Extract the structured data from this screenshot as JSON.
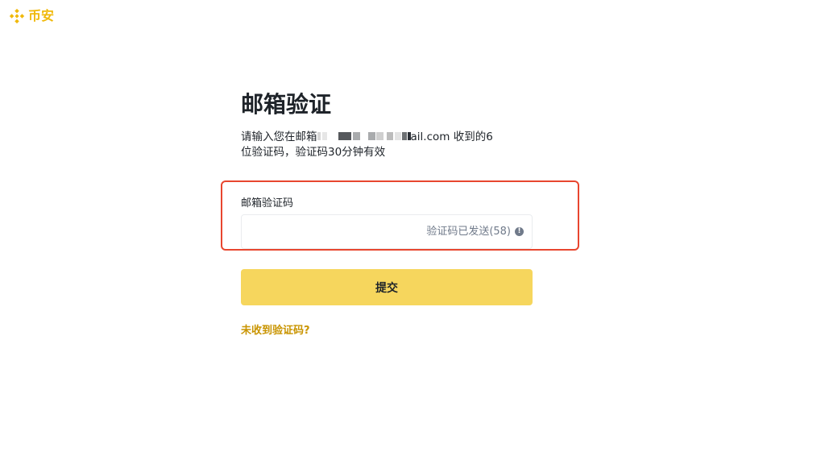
{
  "brand": {
    "name": "币安",
    "color": "#F0B90B"
  },
  "page": {
    "title": "邮箱验证",
    "subtitle_prefix": "请输入您在邮箱",
    "subtitle_suffix": "ail.com 收到的6",
    "subtitle_line2": "位验证码，验证码30分钟有效"
  },
  "form": {
    "code_label": "邮箱验证码",
    "code_value": "",
    "resend_status": "验证码已发送(58)",
    "info_icon": "info-icon",
    "submit_label": "提交",
    "help_link": "未收到验证码?"
  },
  "colors": {
    "accent_button": "#F6D65D",
    "link": "#C99400",
    "highlight_border": "#e8462f"
  }
}
